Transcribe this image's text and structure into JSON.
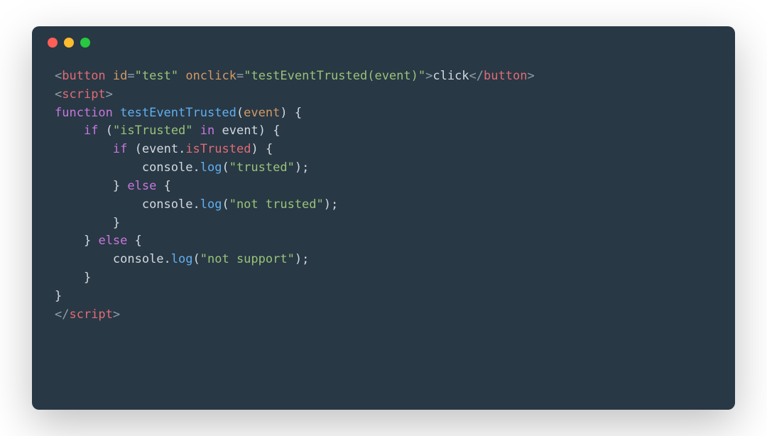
{
  "window": {
    "dots": {
      "red": "#ff5f57",
      "yellow": "#febc2e",
      "green": "#28c840"
    }
  },
  "code": {
    "l1": {
      "open": "<",
      "tag1": "button",
      "sp": " ",
      "attr1": "id",
      "eq1": "=",
      "val1": "\"test\"",
      "attr2": "onclick",
      "eq2": "=",
      "val2": "\"testEventTrusted(event)\"",
      "close": ">",
      "text": "click",
      "open2": "</",
      "tag2": "button",
      "close2": ">"
    },
    "l2": {
      "open": "<",
      "tag": "script",
      "close": ">"
    },
    "l3": {
      "kw": "function",
      "sp": " ",
      "fn": "testEventTrusted",
      "lp": "(",
      "param": "event",
      "rp": ")",
      "sp2": " ",
      "brace": "{"
    },
    "l4": {
      "indent": "    ",
      "kw": "if",
      "sp": " ",
      "lp": "(",
      "str": "\"isTrusted\"",
      "sp2": " ",
      "in": "in",
      "sp3": " ",
      "obj": "event",
      "rp": ")",
      "sp4": " ",
      "brace": "{"
    },
    "l5": {
      "indent": "        ",
      "kw": "if",
      "sp": " ",
      "lp": "(",
      "obj": "event",
      "dot": ".",
      "prop": "isTrusted",
      "rp": ")",
      "sp2": " ",
      "brace": "{"
    },
    "l6": {
      "indent": "            ",
      "obj": "console",
      "dot": ".",
      "method": "log",
      "lp": "(",
      "str": "\"trusted\"",
      "rp": ")",
      "semi": ";"
    },
    "l7": {
      "indent": "        ",
      "brace": "}",
      "sp": " ",
      "kw": "else",
      "sp2": " ",
      "brace2": "{"
    },
    "l8": {
      "indent": "            ",
      "obj": "console",
      "dot": ".",
      "method": "log",
      "lp": "(",
      "str": "\"not trusted\"",
      "rp": ")",
      "semi": ";"
    },
    "l9": {
      "indent": "        ",
      "brace": "}"
    },
    "l10": {
      "indent": "    ",
      "brace": "}",
      "sp": " ",
      "kw": "else",
      "sp2": " ",
      "brace2": "{"
    },
    "l11": {
      "indent": "        ",
      "obj": "console",
      "dot": ".",
      "method": "log",
      "lp": "(",
      "str": "\"not support\"",
      "rp": ")",
      "semi": ";"
    },
    "l12": {
      "indent": "    ",
      "brace": "}"
    },
    "l13": {
      "brace": "}"
    },
    "l14": {
      "open": "</",
      "tag": "script",
      "close": ">"
    }
  }
}
